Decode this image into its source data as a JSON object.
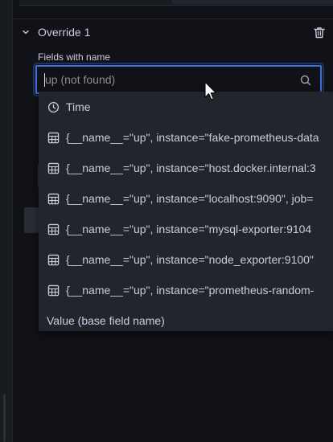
{
  "override": {
    "title": "Override 1"
  },
  "fields": {
    "label": "Fields with name",
    "input_value": "up (not found)"
  },
  "options": [
    {
      "label": "Time",
      "icon": "clock-icon"
    },
    {
      "label": "{__name__=\"up\", instance=\"fake-prometheus-data",
      "icon": "table-icon"
    },
    {
      "label": "{__name__=\"up\", instance=\"host.docker.internal:3",
      "icon": "table-icon"
    },
    {
      "label": "{__name__=\"up\", instance=\"localhost:9090\", job=",
      "icon": "table-icon"
    },
    {
      "label": "{__name__=\"up\", instance=\"mysql-exporter:9104",
      "icon": "table-icon"
    },
    {
      "label": "{__name__=\"up\", instance=\"node_exporter:9100\"",
      "icon": "table-icon"
    },
    {
      "label": "{__name__=\"up\", instance=\"prometheus-random-",
      "icon": "table-icon"
    },
    {
      "label": "Value (base field name)",
      "icon": ""
    }
  ],
  "colors": {
    "focus": "#3d71d9",
    "menu_bg": "#22252b",
    "text": "#ccccdc"
  }
}
